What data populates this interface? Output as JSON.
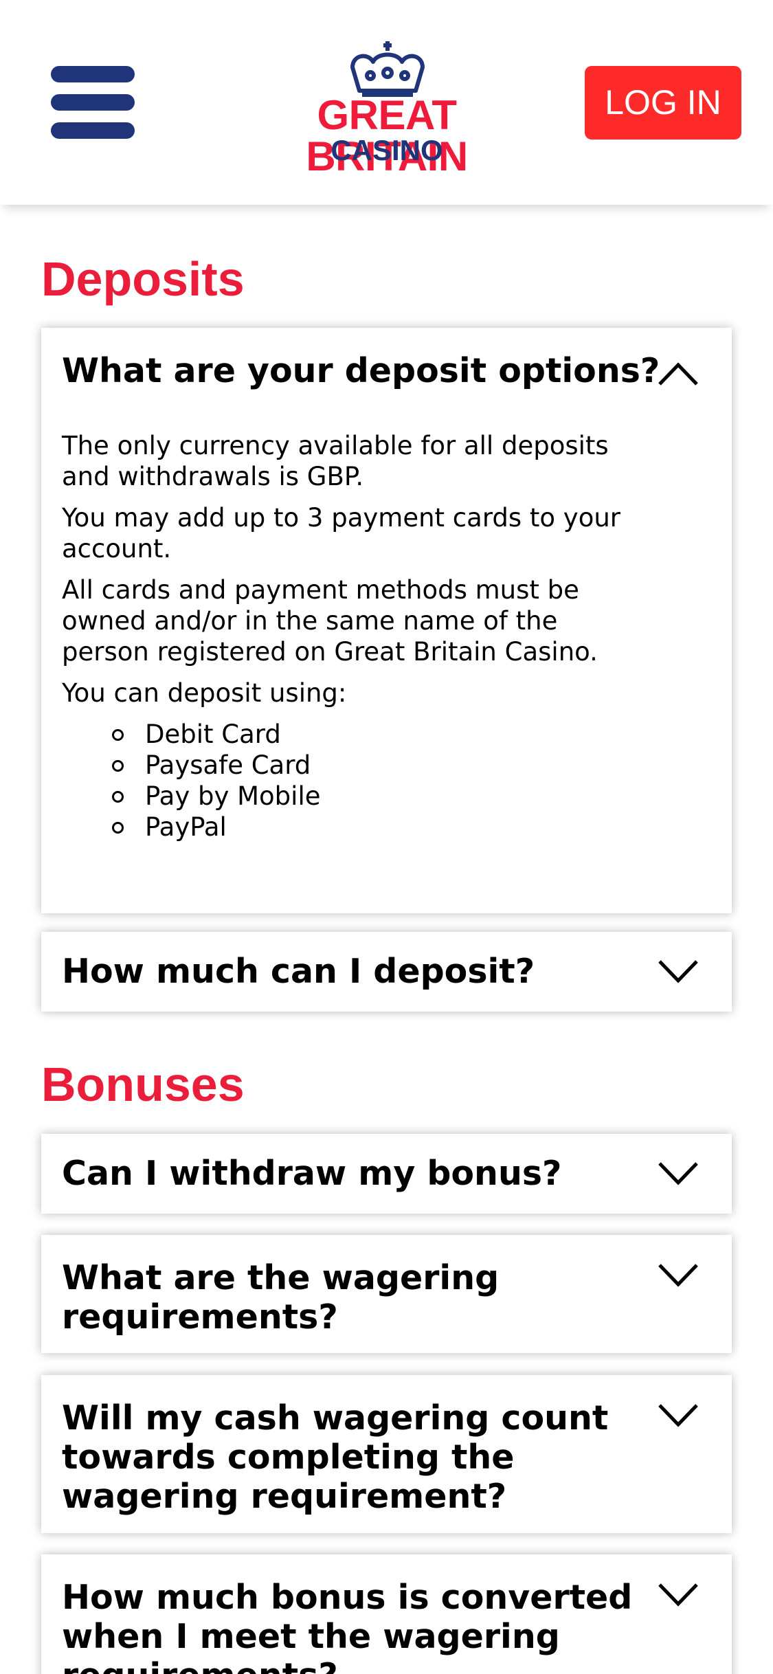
{
  "colors": {
    "brand_red": "#EE1C3A",
    "navy": "#1F3479",
    "login_bg": "#FF2A2A",
    "heading_red": "#EA1D3A"
  },
  "header": {
    "menu_icon": "hamburger-menu-icon",
    "logo": {
      "line1": "GREAT BRITAIN",
      "line2": "CASINO",
      "icon": "crown-icon"
    },
    "login_label": "LOG IN"
  },
  "sections": [
    {
      "title": "Deposits",
      "items": [
        {
          "question": "What are your deposit options?",
          "expanded": true,
          "answer_paragraphs": [
            "The only currency available for all deposits and withdrawals is GBP.",
            "You may add up to 3 payment cards to your account.",
            "All cards and payment methods must be owned and/or in the same name of the person registered on Great Britain Casino.",
            "You can deposit using:"
          ],
          "answer_list": [
            "Debit Card",
            "Paysafe Card",
            "Pay by Mobile",
            "PayPal"
          ]
        },
        {
          "question": "How much can I deposit?",
          "expanded": false
        }
      ]
    },
    {
      "title": "Bonuses",
      "items": [
        {
          "question": "Can I withdraw my bonus?",
          "expanded": false
        },
        {
          "question": "What are the wagering requirements?",
          "expanded": false
        },
        {
          "question": "Will my cash wagering count towards completing the wagering requirement?",
          "expanded": false
        },
        {
          "question": "How much bonus is converted when I meet the wagering requirements?",
          "expanded": false
        }
      ]
    }
  ]
}
